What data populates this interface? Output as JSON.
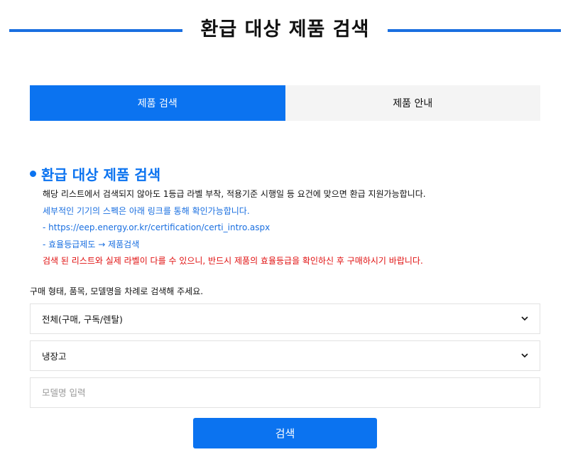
{
  "header": {
    "title": "환급 대상 제품 검색"
  },
  "tabs": [
    {
      "label": "제품 검색",
      "active": true
    },
    {
      "label": "제품 안내",
      "active": false
    }
  ],
  "section": {
    "title": "환급 대상 제품 검색",
    "lines": [
      "해당 리스트에서 검색되지 않아도 1등급 라벨 부착, 적용기준 시행일 등 요건에 맞으면 환급 지원가능합니다.",
      "세부적인 기기의 스펙은 아래 링크를 통해 확인가능합니다.",
      "- https://eep.energy.or.kr/certification/certi_intro.aspx",
      "- 효율등급제도 → 제품검색",
      "검색 된 리스트와 실제 라벨이 다를 수 있으니, 반드시 제품의 효율등급을 확인하신 후 구매하시기 바랍니다."
    ]
  },
  "form": {
    "instruction": "구매 형태, 품목, 모델명을 차례로 검색해 주세요.",
    "purchase_type": {
      "selected": "전체(구매, 구독/렌탈)"
    },
    "product": {
      "selected": "냉장고"
    },
    "model": {
      "value": "",
      "placeholder": "모델명 입력"
    },
    "search_label": "검색"
  },
  "colors": {
    "primary": "#0b73f0",
    "link": "#1a6fe0",
    "warning": "#e01010",
    "tab_inactive_bg": "#f4f4f4"
  }
}
